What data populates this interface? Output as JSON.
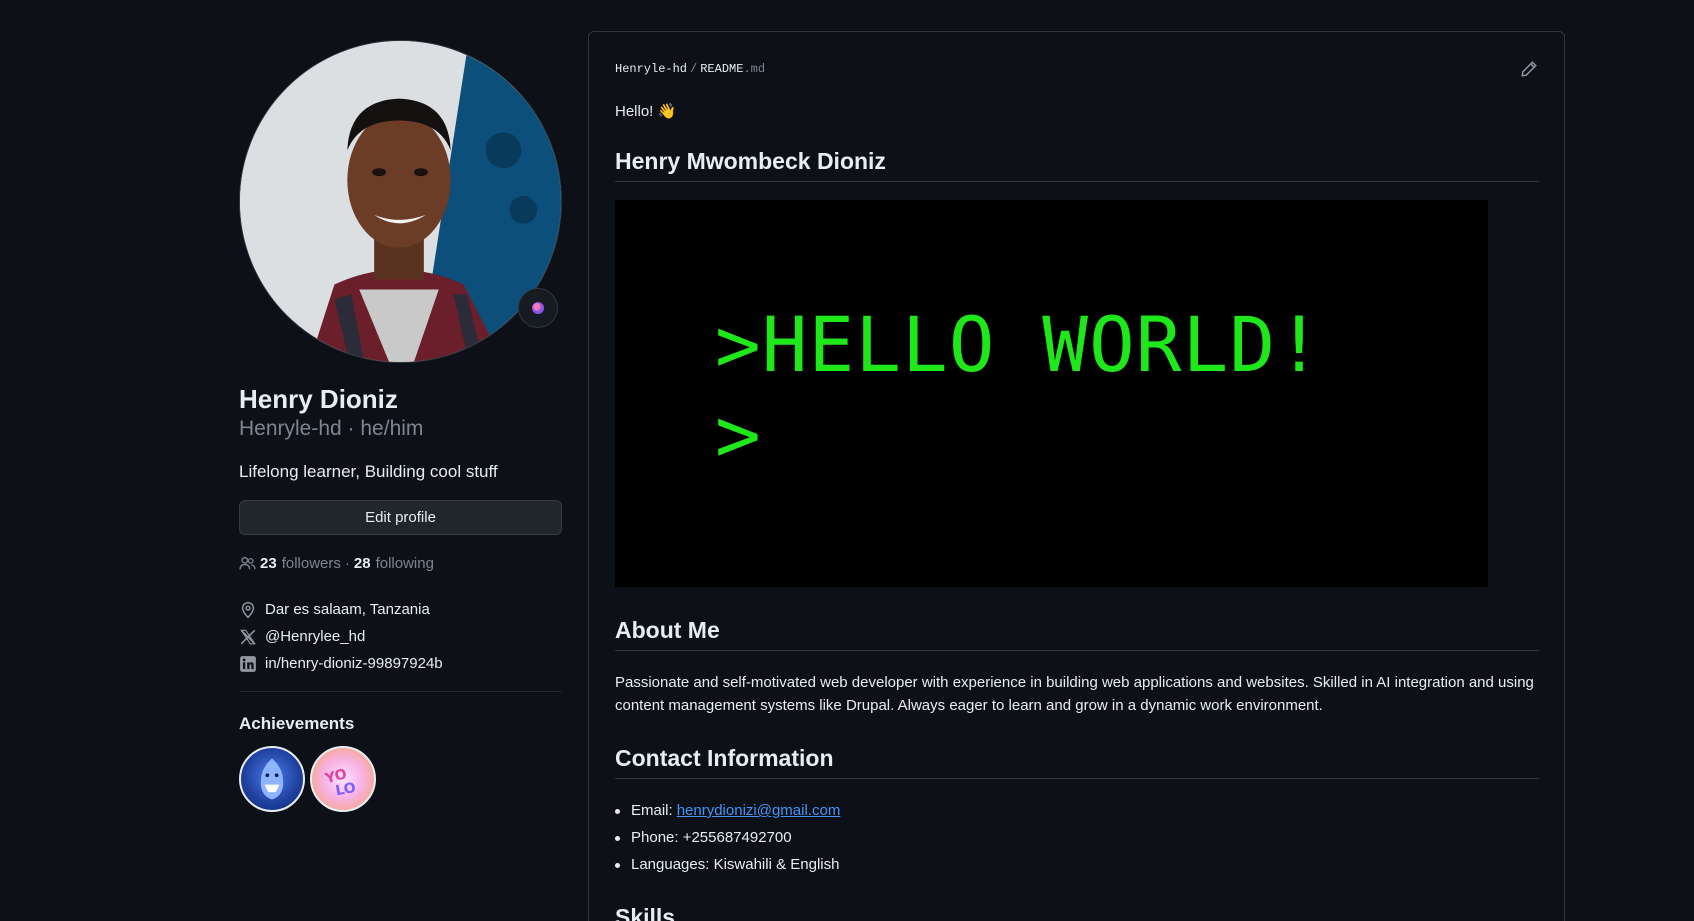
{
  "profile": {
    "name": "Henry Dioniz",
    "login_pronouns": "Henryle-hd · he/him",
    "bio": "Lifelong learner, Building cool stuff",
    "edit_label": "Edit profile",
    "followers_count": "23",
    "followers_label": "followers",
    "separator": "·",
    "following_count": "28",
    "following_label": "following",
    "location": "Dar es salaam, Tanzania",
    "twitter": "@Henrylee_hd",
    "linkedin": "in/henry-dioniz-99897924b",
    "achievements_title": "Achievements"
  },
  "readme": {
    "owner": "Henryle-hd",
    "path_sep": "/",
    "file_name": "README",
    "file_ext": ".md",
    "hello": "Hello! 👋",
    "heading_name": "Henry Mwombeck Dioniz",
    "banner_line1": ">HELLO WORLD!",
    "banner_line2": ">",
    "heading_about": "About Me",
    "about_text": "Passionate and self-motivated web developer with experience in building web applications and websites. Skilled in AI integration and using content management systems like Drupal. Always eager to learn and grow in a dynamic work environment.",
    "heading_contact": "Contact Information",
    "email_label": "Email:",
    "email_value": "henrydionizi@gmail.com",
    "phone": "Phone: +255687492700",
    "languages": "Languages: Kiswahili & English",
    "heading_skills": "Skills"
  },
  "colors": {
    "background": "#0d1117",
    "text": "#e6edf3",
    "muted": "#7d8590",
    "link": "#4493f8",
    "terminal_green": "#1ee81a"
  }
}
